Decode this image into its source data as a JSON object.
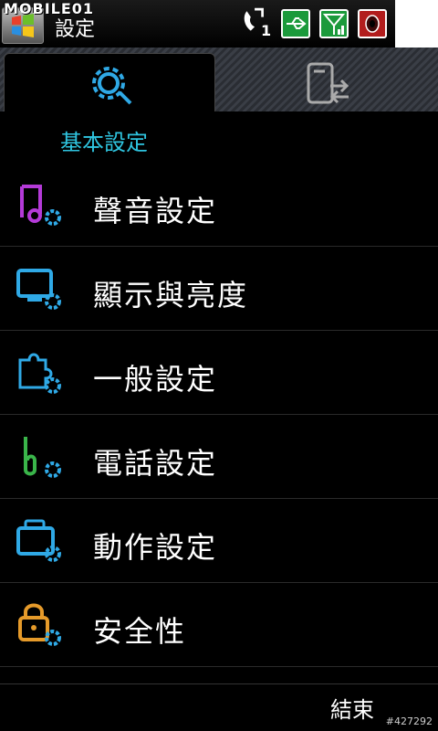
{
  "status_bar": {
    "brand": "MOBILE01",
    "app_title": "設定",
    "missed_calls": "1"
  },
  "tabs": [
    {
      "name": "basic",
      "icon": "gear-wrench-icon",
      "active": true
    },
    {
      "name": "connections",
      "icon": "device-sync-icon",
      "active": false
    }
  ],
  "section_title": "基本設定",
  "menu": {
    "items": [
      {
        "label": "聲音設定",
        "icon": "music-note-gear-icon",
        "color": "#b43ad8"
      },
      {
        "label": "顯示與亮度",
        "icon": "monitor-gear-icon",
        "color": "#2fa9e6"
      },
      {
        "label": "一般設定",
        "icon": "puzzle-gear-icon",
        "color": "#2fa9e6"
      },
      {
        "label": "電話設定",
        "icon": "phone-gear-icon",
        "color": "#3ab54a"
      },
      {
        "label": "動作設定",
        "icon": "folder-gear-icon",
        "color": "#2fa9e6"
      },
      {
        "label": "安全性",
        "icon": "lock-gear-icon",
        "color": "#e59a2a"
      }
    ]
  },
  "footer": {
    "exit_label": "結束",
    "reference": "#427292"
  },
  "colors": {
    "accent": "#2fc5e0",
    "gear": "#2fa9e6"
  }
}
